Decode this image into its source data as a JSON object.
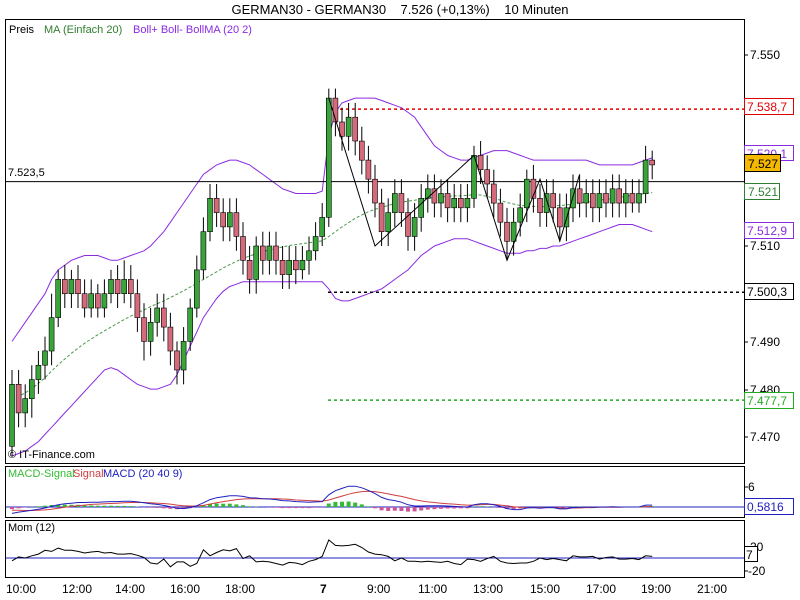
{
  "window": {
    "title": "GERMAN30 - GERMAN30    7.526 (+0,13%)    10 Minuten"
  },
  "legend": {
    "price": "Preis",
    "ma": "MA (Einfach 20)",
    "boll": "Boll+ Boll- BollMA (20 2)"
  },
  "colors": {
    "up": "#3aa43a",
    "down": "#d46a7a",
    "ma": "#4a9a4a",
    "boll": "#8a2be2",
    "red_line": "#e00000",
    "green_line": "#22aa22",
    "macd": "#2020c0",
    "signal": "#d04040",
    "hist_pos": "#33bb33",
    "hist_neg": "#cc5599",
    "current_bg": "#f5b800"
  },
  "watermark": "© IT-Finance.com",
  "price_axis": {
    "ticks": [
      "7.550",
      "7.510",
      "7.490",
      "7.480",
      "7.470"
    ]
  },
  "price_labels": {
    "left_level": "7.523,5",
    "red": "7.538,7",
    "upper": "7.520,1",
    "current": "7.527",
    "mid": "7.521",
    "lower": "7.512,9",
    "black": "7.500,3",
    "green": "7.477,7"
  },
  "macd_panel": {
    "label_a": "MACD-Signal",
    "label_b": "Signal",
    "label_c": "MACD (20 40 9)",
    "tick": "6",
    "value": "0,5816"
  },
  "mom_panel": {
    "label": "Mom (12)",
    "ticks": [
      "20",
      "7",
      "-20"
    ]
  },
  "time_axis": {
    "labels": [
      "10:00",
      "12:00",
      "14:00",
      "16:00",
      "18:00",
      "7",
      "9:00",
      "11:00",
      "13:00",
      "15:00",
      "17:00",
      "19:00",
      "21:00"
    ]
  },
  "chart_data": {
    "type": "candlestick",
    "title": "GERMAN30 - GERMAN30    7.526 (+0,13%)    10 Minuten",
    "interval": "10 Minuten",
    "ylim": [
      7465,
      7558
    ],
    "price_ticks": [
      7550,
      7510,
      7490,
      7480,
      7470
    ],
    "levels": {
      "left": 7523.5,
      "red": 7538.7,
      "black": 7500.3,
      "green": 7477.7,
      "current": 7527
    },
    "ohlc": [
      [
        7468,
        7481,
        7466,
        7484
      ],
      [
        7481,
        7475,
        7472,
        7484
      ],
      [
        7475,
        7478,
        7472,
        7481
      ],
      [
        7478,
        7482,
        7474,
        7485
      ],
      [
        7482,
        7485,
        7479,
        7488
      ],
      [
        7485,
        7488,
        7482,
        7491
      ],
      [
        7488,
        7495,
        7485,
        7500
      ],
      [
        7495,
        7503,
        7493,
        7505
      ],
      [
        7503,
        7500,
        7497,
        7506
      ],
      [
        7500,
        7503,
        7497,
        7505
      ],
      [
        7503,
        7500,
        7497,
        7506
      ],
      [
        7500,
        7497,
        7495,
        7503
      ],
      [
        7497,
        7500,
        7495,
        7503
      ],
      [
        7500,
        7497,
        7495,
        7502
      ],
      [
        7497,
        7500,
        7495,
        7503
      ],
      [
        7500,
        7503,
        7498,
        7505
      ],
      [
        7503,
        7500,
        7497,
        7506
      ],
      [
        7500,
        7503,
        7498,
        7507
      ],
      [
        7503,
        7500,
        7497,
        7506
      ],
      [
        7500,
        7495,
        7492,
        7503
      ],
      [
        7495,
        7490,
        7486,
        7498
      ],
      [
        7490,
        7494,
        7487,
        7497
      ],
      [
        7494,
        7497,
        7491,
        7500
      ],
      [
        7497,
        7493,
        7490,
        7500
      ],
      [
        7493,
        7488,
        7485,
        7496
      ],
      [
        7488,
        7484,
        7481,
        7490
      ],
      [
        7484,
        7490,
        7481,
        7493
      ],
      [
        7490,
        7497,
        7488,
        7499
      ],
      [
        7497,
        7505,
        7495,
        7508
      ],
      [
        7505,
        7513,
        7503,
        7516
      ],
      [
        7513,
        7520,
        7511,
        7523
      ],
      [
        7520,
        7517,
        7514,
        7523
      ],
      [
        7517,
        7514,
        7511,
        7520
      ],
      [
        7514,
        7517,
        7511,
        7520
      ],
      [
        7517,
        7512,
        7509,
        7520
      ],
      [
        7512,
        7507,
        7504,
        7515
      ],
      [
        7507,
        7503,
        7500,
        7510
      ],
      [
        7503,
        7510,
        7500,
        7512
      ],
      [
        7510,
        7507,
        7504,
        7513
      ],
      [
        7507,
        7510,
        7504,
        7513
      ],
      [
        7510,
        7507,
        7504,
        7513
      ],
      [
        7507,
        7504,
        7501,
        7510
      ],
      [
        7504,
        7507,
        7501,
        7510
      ],
      [
        7507,
        7505,
        7502,
        7510
      ],
      [
        7505,
        7507,
        7503,
        7510
      ],
      [
        7507,
        7509,
        7504,
        7512
      ],
      [
        7509,
        7512,
        7507,
        7515
      ],
      [
        7512,
        7516,
        7510,
        7519
      ],
      [
        7516,
        7541,
        7514,
        7543
      ],
      [
        7541,
        7536,
        7533,
        7543
      ],
      [
        7536,
        7533,
        7530,
        7539
      ],
      [
        7533,
        7537,
        7530,
        7540
      ],
      [
        7537,
        7532,
        7529,
        7540
      ],
      [
        7532,
        7528,
        7525,
        7535
      ],
      [
        7528,
        7524,
        7521,
        7531
      ],
      [
        7524,
        7519,
        7516,
        7527
      ],
      [
        7519,
        7513,
        7510,
        7522
      ],
      [
        7513,
        7517,
        7510,
        7520
      ],
      [
        7517,
        7521,
        7514,
        7524
      ],
      [
        7521,
        7517,
        7514,
        7524
      ],
      [
        7517,
        7512,
        7509,
        7520
      ],
      [
        7512,
        7516,
        7509,
        7519
      ],
      [
        7516,
        7520,
        7513,
        7523
      ],
      [
        7520,
        7522,
        7517,
        7525
      ],
      [
        7522,
        7519,
        7516,
        7525
      ],
      [
        7519,
        7521,
        7516,
        7524
      ],
      [
        7521,
        7518,
        7515,
        7524
      ],
      [
        7518,
        7520,
        7515,
        7523
      ],
      [
        7520,
        7518,
        7515,
        7523
      ],
      [
        7518,
        7520,
        7515,
        7523
      ],
      [
        7520,
        7529,
        7518,
        7531
      ],
      [
        7529,
        7526,
        7523,
        7532
      ],
      [
        7526,
        7523,
        7520,
        7529
      ],
      [
        7523,
        7519,
        7516,
        7526
      ],
      [
        7519,
        7515,
        7512,
        7522
      ],
      [
        7515,
        7511,
        7507,
        7518
      ],
      [
        7511,
        7515,
        7508,
        7518
      ],
      [
        7515,
        7518,
        7512,
        7521
      ],
      [
        7518,
        7524,
        7515,
        7526
      ],
      [
        7524,
        7520,
        7517,
        7527
      ],
      [
        7520,
        7517,
        7514,
        7523
      ],
      [
        7517,
        7521,
        7514,
        7524
      ],
      [
        7521,
        7518,
        7515,
        7524
      ],
      [
        7518,
        7514,
        7511,
        7521
      ],
      [
        7514,
        7518,
        7511,
        7521
      ],
      [
        7518,
        7522,
        7515,
        7525
      ],
      [
        7522,
        7519,
        7516,
        7525
      ],
      [
        7519,
        7521,
        7516,
        7524
      ],
      [
        7521,
        7518,
        7515,
        7524
      ],
      [
        7518,
        7521,
        7515,
        7524
      ],
      [
        7521,
        7519,
        7516,
        7524
      ],
      [
        7519,
        7522,
        7516,
        7525
      ],
      [
        7522,
        7519,
        7516,
        7525
      ],
      [
        7519,
        7521,
        7516,
        7524
      ],
      [
        7521,
        7519,
        7517,
        7524
      ],
      [
        7519,
        7521,
        7517,
        7524
      ],
      [
        7521,
        7528,
        7519,
        7531
      ],
      [
        7528,
        7527,
        7524,
        7530
      ]
    ],
    "ma20": [
      7478.0,
      7478.5,
      7479.2,
      7480.1,
      7481.2,
      7482.4,
      7483.8,
      7485.1,
      7486.3,
      7487.5,
      7488.6,
      7489.6,
      7490.5,
      7491.4,
      7492.2,
      7493.0,
      7493.8,
      7494.6,
      7495.3,
      7496.0,
      7496.6,
      7497.3,
      7497.9,
      7498.5,
      7499.2,
      7499.9,
      7500.6,
      7501.4,
      7502.2,
      7503.0,
      7503.8,
      7504.6,
      7505.4,
      7506.1,
      7506.8,
      7507.4,
      7507.9,
      7508.4,
      7508.8,
      7509.2,
      7509.5,
      7509.8,
      7510.1,
      7510.3,
      7510.5,
      7510.7,
      7510.9,
      7511.1,
      7512.0,
      7513.0,
      7514.0,
      7514.9,
      7515.8,
      7516.5,
      7517.2,
      7517.7,
      7518.1,
      7518.5,
      7518.9,
      7519.2,
      7519.4,
      7519.6,
      7519.8,
      7520.0,
      7520.2,
      7520.3,
      7520.4,
      7520.5,
      7520.5,
      7520.6,
      7520.8,
      7520.7,
      7520.4,
      7520.0,
      7519.6,
      7519.1,
      7518.8,
      7518.5,
      7518.4,
      7518.3,
      7518.2,
      7518.3,
      7518.4,
      7518.5,
      7518.6,
      7518.8,
      7519.0,
      7519.2,
      7519.4,
      7519.6,
      7519.8,
      7520.0,
      7520.2,
      7520.4,
      7520.6,
      7520.8,
      7521.0,
      7521.2
    ],
    "boll_upper": [
      7490.0,
      7492.0,
      7494.0,
      7496.0,
      7498.0,
      7500.0,
      7503.0,
      7505.0,
      7506.0,
      7507.0,
      7507.5,
      7508.0,
      7508.0,
      7508.0,
      7507.5,
      7507.0,
      7507.0,
      7507.5,
      7508.0,
      7508.5,
      7509.0,
      7510.0,
      7511.5,
      7513.0,
      7515.0,
      7517.0,
      7519.0,
      7521.0,
      7523.0,
      7525.0,
      7526.0,
      7527.0,
      7527.5,
      7528.0,
      7528.0,
      7527.5,
      7527.0,
      7526.0,
      7525.0,
      7524.0,
      7523.0,
      7522.0,
      7521.5,
      7521.0,
      7521.0,
      7521.0,
      7521.0,
      7521.5,
      7533.0,
      7538.0,
      7540.0,
      7540.5,
      7541.0,
      7541.0,
      7541.0,
      7541.0,
      7540.5,
      7540.0,
      7539.5,
      7539.0,
      7538.0,
      7537.0,
      7535.0,
      7533.0,
      7531.0,
      7530.0,
      7529.0,
      7528.5,
      7528.0,
      7528.0,
      7528.5,
      7529.0,
      7529.5,
      7530.0,
      7530.0,
      7530.0,
      7529.5,
      7529.0,
      7528.5,
      7528.0,
      7528.0,
      7528.0,
      7528.0,
      7528.0,
      7528.0,
      7528.0,
      7528.0,
      7528.0,
      7527.5,
      7527.0,
      7527.0,
      7527.0,
      7527.0,
      7527.0,
      7527.0,
      7527.5,
      7528.0,
      7528.5
    ],
    "boll_lower": [
      7466.0,
      7466.5,
      7467.0,
      7468.0,
      7469.0,
      7470.5,
      7472.0,
      7473.5,
      7475.0,
      7476.5,
      7478.0,
      7479.5,
      7481.0,
      7482.5,
      7484.0,
      7484.5,
      7484.0,
      7483.0,
      7482.0,
      7481.0,
      7480.5,
      7480.0,
      7480.0,
      7480.5,
      7481.0,
      7483.0,
      7486.0,
      7489.0,
      7492.0,
      7495.0,
      7497.0,
      7499.0,
      7500.5,
      7501.5,
      7502.0,
      7502.5,
      7502.5,
      7502.5,
      7502.5,
      7502.5,
      7502.5,
      7502.5,
      7502.5,
      7502.5,
      7502.5,
      7502.5,
      7502.5,
      7502.5,
      7501.0,
      7499.0,
      7498.5,
      7498.5,
      7499.0,
      7499.5,
      7500.0,
      7500.5,
      7501.0,
      7502.0,
      7503.0,
      7504.0,
      7505.0,
      7506.5,
      7508.0,
      7509.0,
      7510.0,
      7510.5,
      7511.0,
      7511.5,
      7511.5,
      7511.5,
      7511.0,
      7510.5,
      7510.0,
      7509.5,
      7509.0,
      7508.5,
      7508.5,
      7508.5,
      7509.0,
      7509.0,
      7509.5,
      7509.5,
      7510.0,
      7510.0,
      7510.5,
      7511.0,
      7511.5,
      7512.0,
      7512.5,
      7513.0,
      7513.5,
      7514.0,
      7514.5,
      7514.5,
      7514.5,
      7514.0,
      7513.5,
      7513.0
    ],
    "zigzag": [
      [
        48,
        7541
      ],
      [
        55,
        7510
      ],
      [
        70,
        7529
      ],
      [
        75,
        7507
      ],
      [
        80,
        7524
      ],
      [
        83,
        7511
      ],
      [
        86,
        7525
      ]
    ],
    "macd": [
      -2.0,
      -1.6,
      -1.3,
      -1.0,
      -0.7,
      -0.3,
      0.2,
      0.7,
      1.0,
      1.2,
      1.4,
      1.4,
      1.5,
      1.5,
      1.6,
      1.7,
      1.7,
      1.8,
      1.8,
      1.6,
      1.3,
      1.0,
      0.8,
      0.5,
      0.1,
      -0.4,
      -0.5,
      -0.2,
      0.4,
      1.3,
      2.3,
      2.9,
      3.2,
      3.5,
      3.5,
      3.3,
      2.9,
      2.8,
      2.6,
      2.5,
      2.3,
      2.0,
      1.9,
      1.7,
      1.6,
      1.5,
      1.6,
      1.7,
      3.8,
      5.1,
      5.8,
      6.5,
      6.5,
      6.0,
      5.2,
      4.2,
      3.0,
      2.3,
      2.0,
      1.5,
      0.7,
      0.3,
      0.3,
      0.4,
      0.4,
      0.4,
      0.3,
      0.2,
      0.1,
      0.0,
      0.7,
      1.0,
      1.0,
      0.7,
      0.2,
      -0.5,
      -0.8,
      -0.8,
      -0.3,
      -0.2,
      -0.4,
      -0.2,
      -0.2,
      -0.6,
      -0.6,
      -0.2,
      -0.1,
      0.0,
      -0.1,
      0.0,
      0.0,
      0.1,
      0.0,
      0.0,
      0.0,
      0.0,
      0.6,
      0.6
    ],
    "signal": [
      -1.0,
      -1.0,
      -1.1,
      -1.1,
      -1.0,
      -0.9,
      -0.7,
      -0.4,
      -0.1,
      0.2,
      0.4,
      0.6,
      0.8,
      0.9,
      1.0,
      1.1,
      1.2,
      1.3,
      1.4,
      1.4,
      1.4,
      1.3,
      1.2,
      1.1,
      0.9,
      0.6,
      0.4,
      0.3,
      0.3,
      0.5,
      0.9,
      1.3,
      1.7,
      2.0,
      2.3,
      2.5,
      2.6,
      2.6,
      2.6,
      2.6,
      2.6,
      2.5,
      2.4,
      2.2,
      2.1,
      2.0,
      1.9,
      1.8,
      2.2,
      2.8,
      3.4,
      4.0,
      4.5,
      4.8,
      4.9,
      4.8,
      4.5,
      4.1,
      3.7,
      3.3,
      2.8,
      2.3,
      1.9,
      1.6,
      1.4,
      1.2,
      1.0,
      0.9,
      0.7,
      0.6,
      0.6,
      0.7,
      0.8,
      0.8,
      0.6,
      0.4,
      0.1,
      -0.1,
      -0.2,
      -0.2,
      -0.2,
      -0.2,
      -0.2,
      -0.3,
      -0.4,
      -0.3,
      -0.3,
      -0.2,
      -0.2,
      -0.1,
      -0.1,
      -0.1,
      -0.1,
      0.0,
      0.0,
      0.0,
      0.1,
      0.2
    ],
    "momentum": [
      -5,
      2,
      0,
      4,
      7,
      14,
      12,
      18,
      14,
      14,
      12,
      9,
      11,
      12,
      9,
      10,
      7,
      7,
      8,
      5,
      1,
      -9,
      -11,
      -2,
      -16,
      -7,
      -7,
      -15,
      -10,
      15,
      4,
      10,
      15,
      13,
      17,
      -1,
      4,
      -7,
      -6,
      -7,
      -10,
      -13,
      -8,
      -9,
      -12,
      -6,
      -3,
      3,
      33,
      23,
      22,
      23,
      25,
      19,
      11,
      7,
      6,
      3,
      -5,
      0,
      -6,
      -6,
      -7,
      -6,
      -7,
      -8,
      -6,
      -10,
      -12,
      -2,
      -3,
      -6,
      -1,
      3,
      -6,
      -9,
      -10,
      -9,
      -9,
      -6,
      0,
      -3,
      -1,
      -3,
      -5,
      4,
      2,
      2,
      3,
      -2,
      1,
      2,
      -2,
      -2,
      -1,
      -3,
      4,
      3
    ]
  }
}
